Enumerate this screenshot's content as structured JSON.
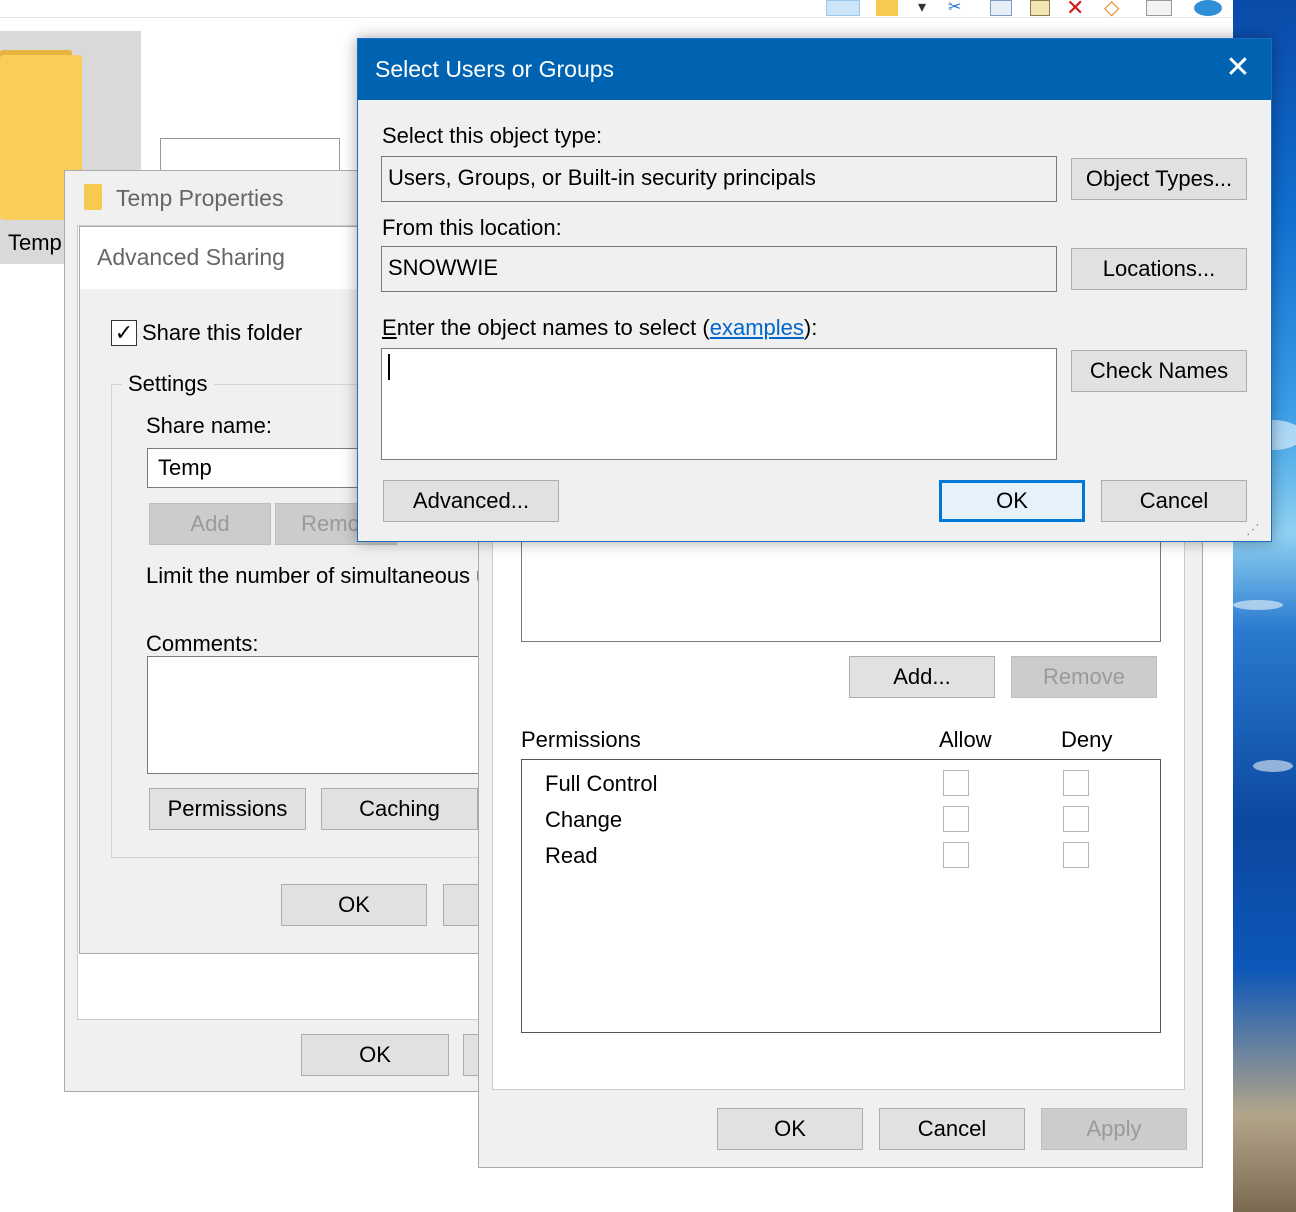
{
  "colors": {
    "accent": "#0063b1",
    "link": "#0066cc",
    "focus_border": "#0078d7"
  },
  "explorer": {
    "folder_label": "Temp",
    "toolbar_icons": [
      "layout-icon",
      "folder-icon",
      "pin-icon",
      "cut-icon",
      "copy-icon",
      "paste-icon",
      "delete-icon",
      "undo-icon",
      "properties-icon",
      "app-icon"
    ]
  },
  "properties_window": {
    "title": "Temp Properties",
    "ok_label": "OK"
  },
  "advanced_sharing": {
    "title": "Advanced Sharing",
    "share_checkbox_label": "Share this folder",
    "share_checked": true,
    "settings_label": "Settings",
    "share_name_label": "Share name:",
    "share_name_value": "Temp",
    "add_label": "Add",
    "remove_label": "Remov",
    "limit_text": "Limit the number of simultaneous u",
    "comments_label": "Comments:",
    "permissions_label": "Permissions",
    "caching_label": "Caching",
    "ok_label": "OK"
  },
  "permissions_window": {
    "add_label": "Add...",
    "remove_label": "Remove",
    "header_permissions": "Permissions",
    "header_allow": "Allow",
    "header_deny": "Deny",
    "rows": [
      {
        "label": "Full Control",
        "allow": false,
        "deny": false
      },
      {
        "label": "Change",
        "allow": false,
        "deny": false
      },
      {
        "label": "Read",
        "allow": false,
        "deny": false
      }
    ],
    "ok_label": "OK",
    "cancel_label": "Cancel",
    "apply_label": "Apply"
  },
  "select_dialog": {
    "title": "Select Users or Groups",
    "object_type_label": "Select this object type:",
    "object_type_value": "Users, Groups, or Built-in security principals",
    "object_types_button": "Object Types...",
    "location_label": "From this location:",
    "location_value": "SNOWWIE",
    "locations_button": "Locations...",
    "names_label_prefix": "nter the object names to select (",
    "names_label_accel": "E",
    "names_label_link": "examples",
    "names_label_suffix": "):",
    "names_value": "",
    "check_names_button": "Check Names",
    "advanced_button": "Advanced...",
    "ok_button": "OK",
    "cancel_button": "Cancel",
    "close_glyph": "✕"
  }
}
